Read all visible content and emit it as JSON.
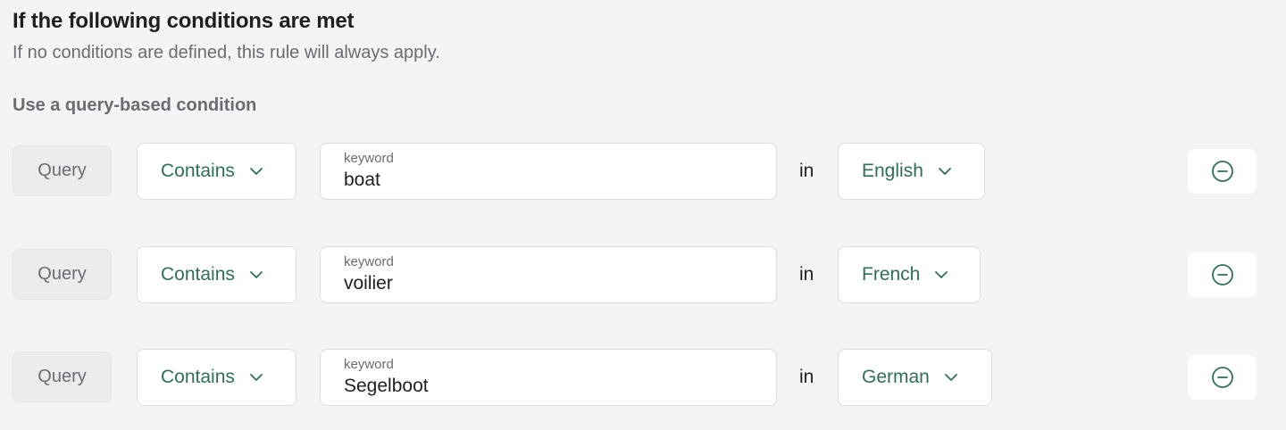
{
  "header": {
    "title": "If the following conditions are met",
    "subtitle": "If no conditions are defined, this rule will always apply."
  },
  "section": {
    "label": "Use a query-based condition"
  },
  "conditions": [
    {
      "type_label": "Query",
      "operator": "Contains",
      "keyword_label": "keyword",
      "keyword_value": "boat",
      "in_label": "in",
      "language": "English"
    },
    {
      "type_label": "Query",
      "operator": "Contains",
      "keyword_label": "keyword",
      "keyword_value": "voilier",
      "in_label": "in",
      "language": "French"
    },
    {
      "type_label": "Query",
      "operator": "Contains",
      "keyword_label": "keyword",
      "keyword_value": "Segelboot",
      "in_label": "in",
      "language": "German"
    }
  ],
  "icons": {
    "dropdown": "chevron-down-icon",
    "remove": "minus-circle-icon"
  },
  "colors": {
    "accent": "#2f6f57",
    "background": "#f4f4f5",
    "muted_text": "#6b6b73"
  }
}
